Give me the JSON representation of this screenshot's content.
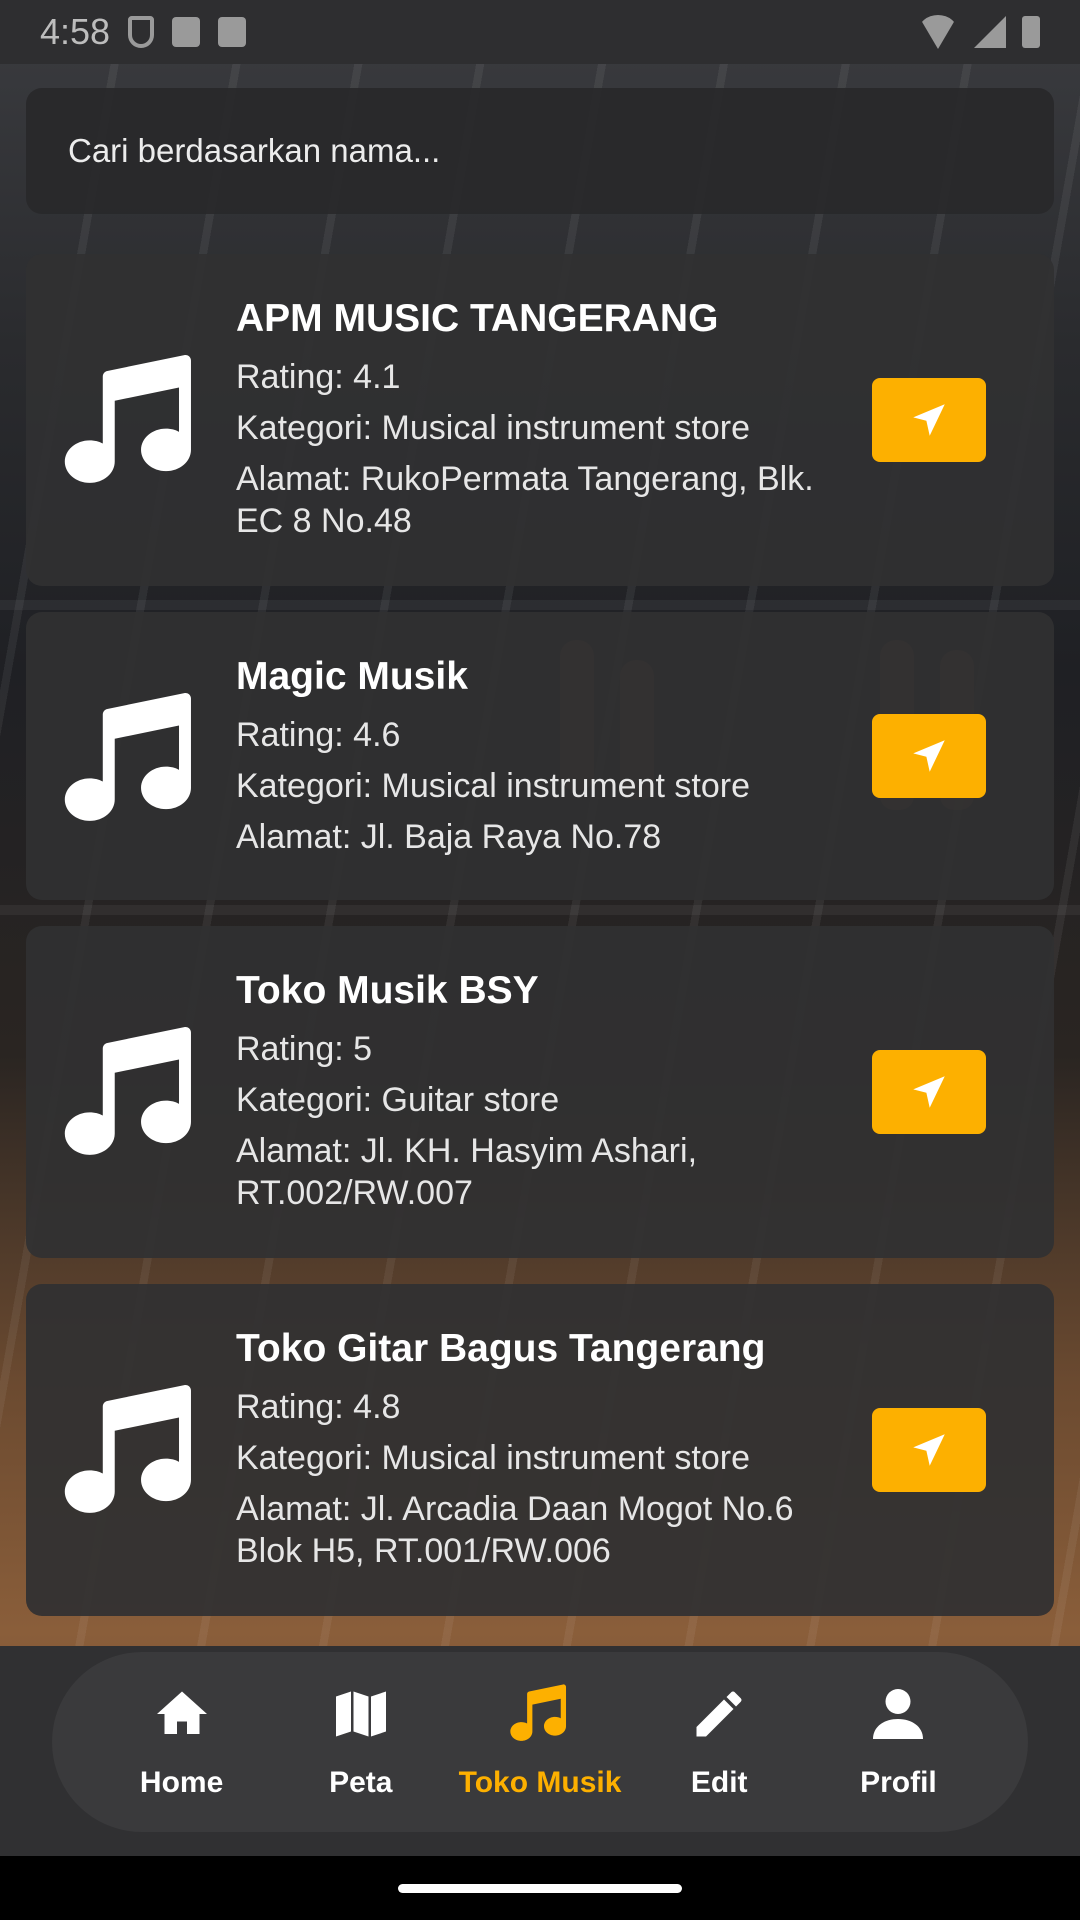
{
  "status_bar": {
    "time": "4:58"
  },
  "search": {
    "placeholder": "Cari berdasarkan nama..."
  },
  "stores": [
    {
      "name": "APM MUSIC TANGERANG",
      "rating": "Rating: 4.1",
      "category": "Kategori: Musical instrument store",
      "address": "Alamat: RukoPermata Tangerang, Blk. EC 8 No.48"
    },
    {
      "name": "Magic Musik",
      "rating": "Rating: 4.6",
      "category": "Kategori: Musical instrument store",
      "address": "Alamat: Jl. Baja Raya No.78"
    },
    {
      "name": "Toko Musik BSY",
      "rating": "Rating: 5",
      "category": "Kategori: Guitar store",
      "address": "Alamat: Jl. KH. Hasyim Ashari, RT.002/RW.007"
    },
    {
      "name": "Toko Gitar Bagus Tangerang",
      "rating": "Rating: 4.8",
      "category": "Kategori: Musical instrument store",
      "address": "Alamat: Jl. Arcadia Daan Mogot No.6 Blok H5, RT.001/RW.006"
    }
  ],
  "bottom_nav": {
    "items": [
      {
        "label": "Home",
        "icon": "home-icon"
      },
      {
        "label": "Peta",
        "icon": "map-icon"
      },
      {
        "label": "Toko Musik",
        "icon": "music-note-icon",
        "active": true
      },
      {
        "label": "Edit",
        "icon": "pencil-icon"
      },
      {
        "label": "Profil",
        "icon": "person-icon"
      }
    ]
  },
  "colors": {
    "accent": "#fdb000",
    "card_bg": "#303032",
    "nav_bg": "#3a3a3c"
  }
}
